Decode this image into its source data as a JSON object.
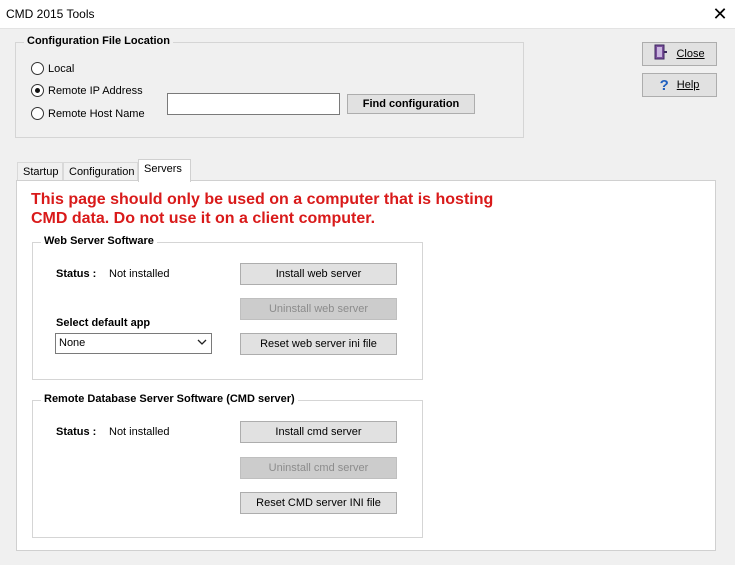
{
  "window": {
    "title": "CMD 2015 Tools",
    "close_glyph": "✕"
  },
  "config": {
    "legend": "Configuration File Location",
    "radios": [
      {
        "label": "Local",
        "checked": false
      },
      {
        "label": "Remote IP Address",
        "checked": true
      },
      {
        "label": "Remote Host Name",
        "checked": false
      }
    ],
    "address_value": "",
    "find_button": "Find configuration"
  },
  "side": {
    "close_label": "Close",
    "help_label": "Help",
    "close_icon": "door-exit-icon",
    "help_icon": "question-mark-icon"
  },
  "tabs": [
    {
      "label": "Startup",
      "active": false
    },
    {
      "label": "Configuration",
      "active": false
    },
    {
      "label": "Servers",
      "active": true
    }
  ],
  "servers": {
    "warning": "This page should only be used on a computer that is hosting CMD data. Do not use it on a client computer.",
    "web": {
      "legend": "Web Server Software",
      "status_label": "Status :",
      "status_value": "Not installed",
      "install_button": "Install web server",
      "uninstall_button": "Uninstall web server",
      "default_app_label": "Select default app",
      "default_app_value": "None",
      "reset_button": "Reset web server ini file"
    },
    "cmd": {
      "legend": "Remote Database Server Software (CMD server)",
      "status_label": "Status :",
      "status_value": "Not installed",
      "install_button": "Install cmd server",
      "uninstall_button": "Uninstall cmd server",
      "reset_button": "Reset CMD server INI file"
    }
  }
}
